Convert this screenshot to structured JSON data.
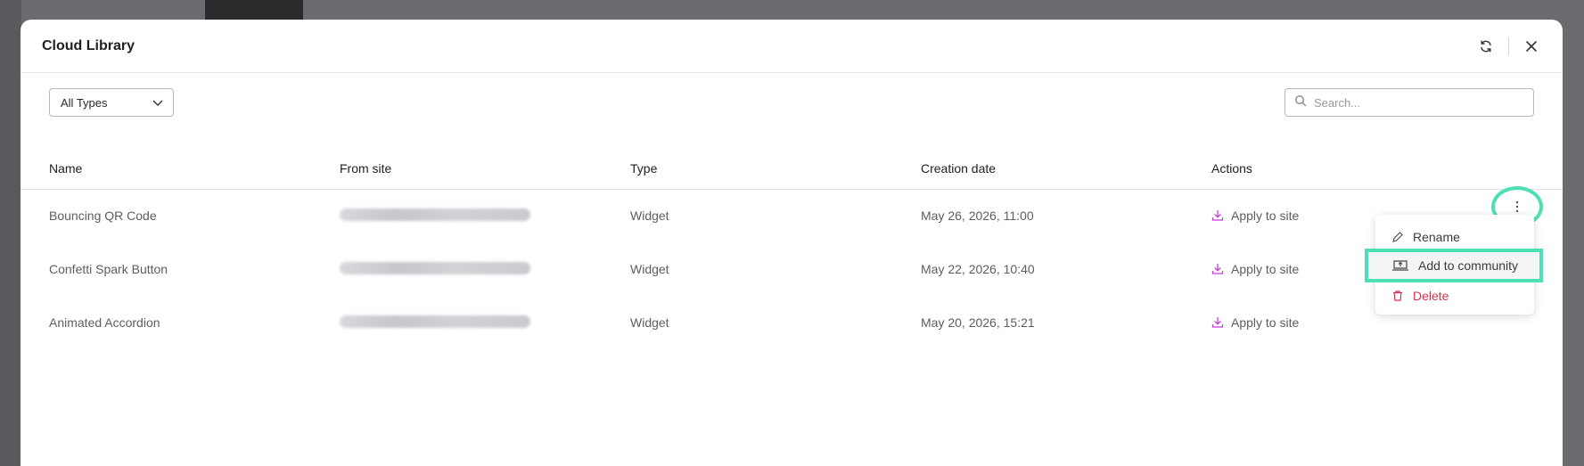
{
  "modal": {
    "title": "Cloud Library"
  },
  "filter": {
    "selected": "All Types"
  },
  "search": {
    "placeholder": "Search..."
  },
  "table": {
    "headers": [
      "Name",
      "From site",
      "Type",
      "Creation date",
      "Actions"
    ],
    "rows": [
      {
        "name": "Bouncing QR Code",
        "type": "Widget",
        "date": "May 26, 2026, 11:00",
        "action": "Apply to site"
      },
      {
        "name": "Confetti Spark Button",
        "type": "Widget",
        "date": "May 22, 2026, 10:40",
        "action": "Apply to site"
      },
      {
        "name": "Animated Accordion",
        "type": "Widget",
        "date": "May 20, 2026, 15:21",
        "action": "Apply to site"
      }
    ]
  },
  "menu": {
    "items": [
      {
        "label": "Rename",
        "icon": "pencil-icon"
      },
      {
        "label": "Add to community",
        "icon": "community-upload-icon"
      },
      {
        "label": "Delete",
        "icon": "trash-icon"
      }
    ]
  },
  "colors": {
    "accent": "#c53fd6",
    "highlight": "#4de0b4",
    "danger": "#d9304a"
  }
}
